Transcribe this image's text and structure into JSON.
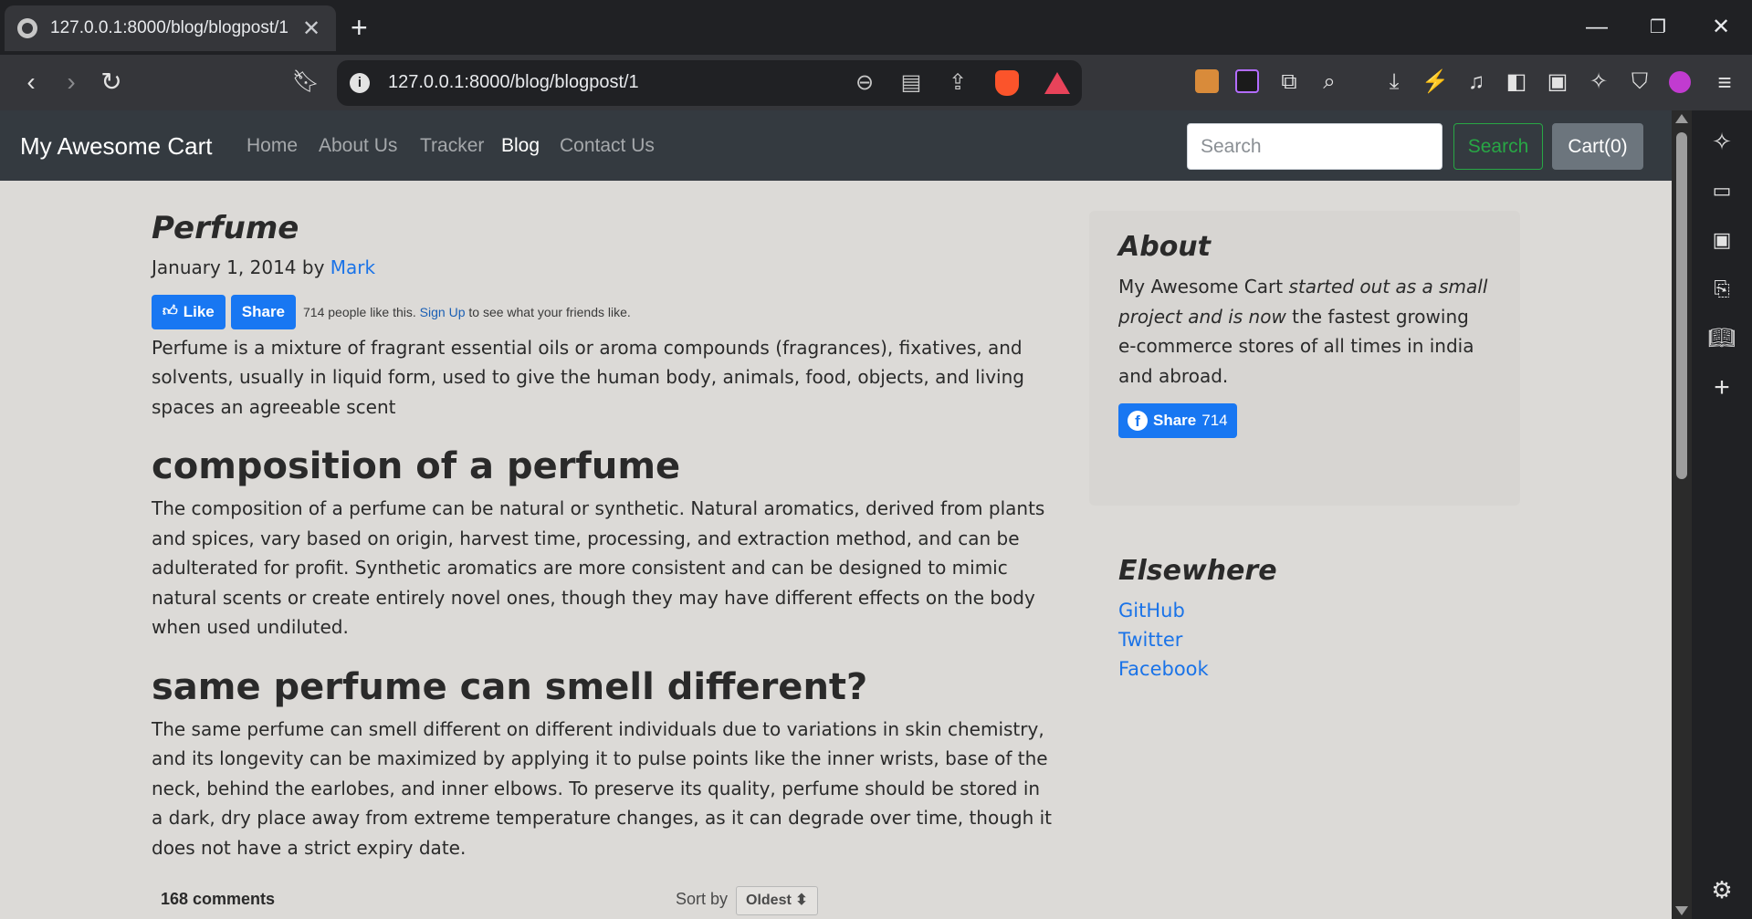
{
  "browser": {
    "tab_title": "127.0.0.1:8000/blog/blogpost/1",
    "url": "127.0.0.1:8000/blog/blogpost/1"
  },
  "navbar": {
    "brand": "My Awesome Cart",
    "links": [
      "Home",
      "About Us",
      "Tracker",
      "Blog",
      "Contact Us"
    ],
    "active_link": "Blog",
    "search_placeholder": "Search",
    "search_button": "Search",
    "cart_button": "Cart(0)"
  },
  "post": {
    "title": "Perfume",
    "date": "January 1, 2014 by",
    "author": "Mark",
    "fb": {
      "like_label": "Like",
      "share_label": "Share",
      "like_text": "714 people like this.",
      "signup_link": "Sign Up",
      "signup_suffix": "to see what your friends like."
    },
    "intro": "Perfume is a mixture of fragrant essential oils or aroma compounds (fragrances), fixatives, and solvents, usually in liquid form, used to give the human body, animals, food, objects, and living spaces an agreeable scent",
    "sections": [
      {
        "heading": "composition of a perfume",
        "body": "The composition of a perfume can be natural or synthetic. Natural aromatics, derived from plants and spices, vary based on origin, harvest time, processing, and extraction method, and can be adulterated for profit. Synthetic aromatics are more consistent and can be designed to mimic natural scents or create entirely novel ones, though they may have different effects on the body when used undiluted."
      },
      {
        "heading": "same perfume can smell different?",
        "body": "The same perfume can smell different on different individuals due to variations in skin chemistry, and its longevity can be maximized by applying it to pulse points like the inner wrists, base of the neck, behind the earlobes, and inner elbows. To preserve its quality, perfume should be stored in a dark, dry place away from extreme temperature changes, as it can degrade over time, though it does not have a strict expiry date."
      }
    ],
    "comments": {
      "count_label": "168 comments",
      "sort_label": "Sort by",
      "sort_value": "Oldest ⬍"
    }
  },
  "sidebar": {
    "about": {
      "heading": "About",
      "text_1": "My Awesome Cart ",
      "text_2_italic": "started out as a small project and is now",
      "text_3": " the fastest growing e-commerce stores of all times in india and abroad.",
      "share_label": "Share",
      "share_count": "714"
    },
    "elsewhere": {
      "heading": "Elsewhere",
      "links": [
        "GitHub",
        "Twitter",
        "Facebook"
      ]
    }
  },
  "colors": {
    "navbar_bg": "#343a40",
    "page_bg": "#dcdad7",
    "link": "#1a73e8",
    "facebook": "#1877f2",
    "search_green": "#28a745"
  }
}
